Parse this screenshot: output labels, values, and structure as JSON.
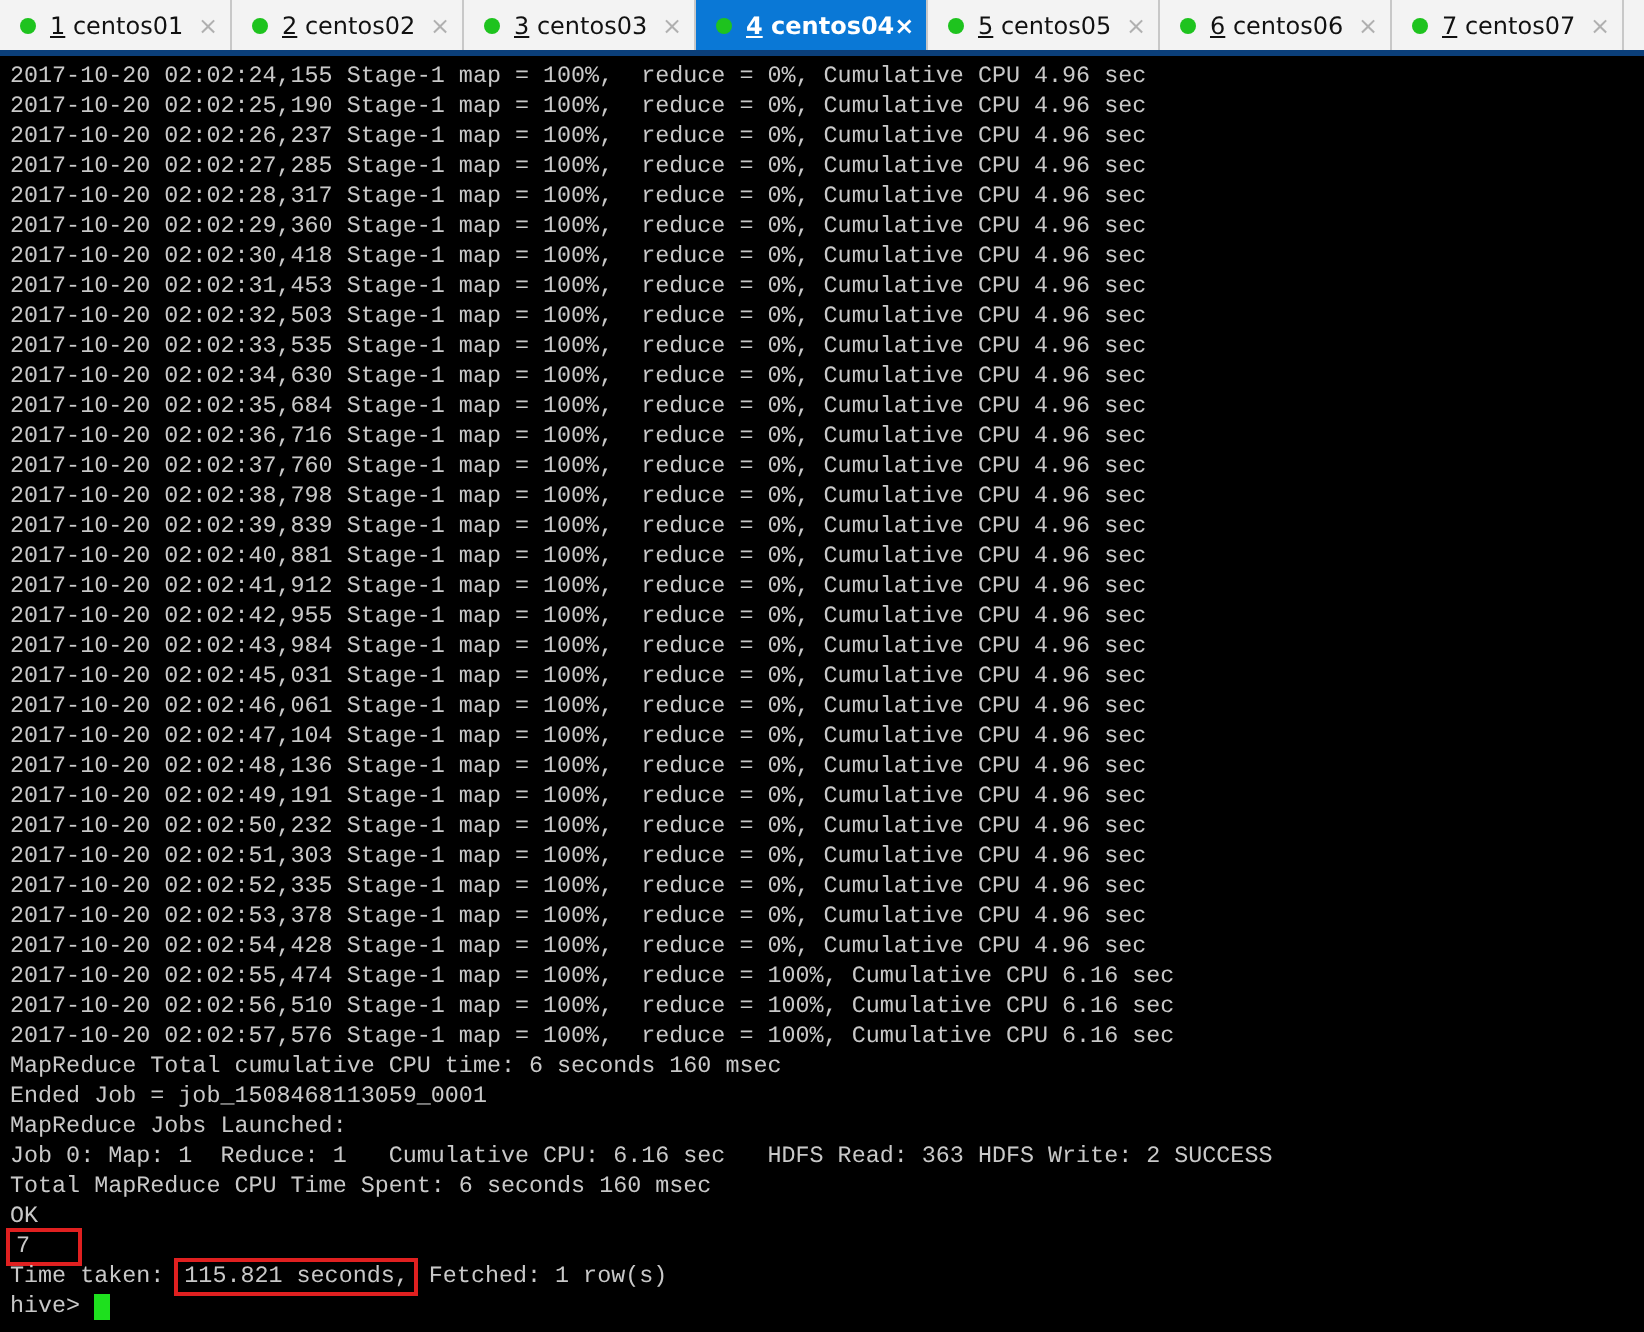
{
  "tabs": [
    {
      "number": "1",
      "label": "centos01",
      "selected": false,
      "color": "#1ec31e",
      "close": "×"
    },
    {
      "number": "2",
      "label": "centos02",
      "selected": false,
      "color": "#1ec31e",
      "close": "×"
    },
    {
      "number": "3",
      "label": "centos03",
      "selected": false,
      "color": "#1ec31e",
      "close": "×"
    },
    {
      "number": "4",
      "label": "centos04",
      "selected": true,
      "color": "#1ec31e",
      "close": "×"
    },
    {
      "number": "5",
      "label": "centos05",
      "selected": false,
      "color": "#1ec31e",
      "close": "×"
    },
    {
      "number": "6",
      "label": "centos06",
      "selected": false,
      "color": "#1ec31e",
      "close": "×"
    },
    {
      "number": "7",
      "label": "centos07",
      "selected": false,
      "color": "#1ec31e",
      "close": "×"
    }
  ],
  "terminal": {
    "lines": [
      {
        "kind": "plain",
        "text": "2017-10-20 02:02:24,155 Stage-1 map = 100%,  reduce = 0%, Cumulative CPU 4.96 sec"
      },
      {
        "kind": "plain",
        "text": "2017-10-20 02:02:25,190 Stage-1 map = 100%,  reduce = 0%, Cumulative CPU 4.96 sec"
      },
      {
        "kind": "plain",
        "text": "2017-10-20 02:02:26,237 Stage-1 map = 100%,  reduce = 0%, Cumulative CPU 4.96 sec"
      },
      {
        "kind": "plain",
        "text": "2017-10-20 02:02:27,285 Stage-1 map = 100%,  reduce = 0%, Cumulative CPU 4.96 sec"
      },
      {
        "kind": "plain",
        "text": "2017-10-20 02:02:28,317 Stage-1 map = 100%,  reduce = 0%, Cumulative CPU 4.96 sec"
      },
      {
        "kind": "plain",
        "text": "2017-10-20 02:02:29,360 Stage-1 map = 100%,  reduce = 0%, Cumulative CPU 4.96 sec"
      },
      {
        "kind": "plain",
        "text": "2017-10-20 02:02:30,418 Stage-1 map = 100%,  reduce = 0%, Cumulative CPU 4.96 sec"
      },
      {
        "kind": "plain",
        "text": "2017-10-20 02:02:31,453 Stage-1 map = 100%,  reduce = 0%, Cumulative CPU 4.96 sec"
      },
      {
        "kind": "plain",
        "text": "2017-10-20 02:02:32,503 Stage-1 map = 100%,  reduce = 0%, Cumulative CPU 4.96 sec"
      },
      {
        "kind": "plain",
        "text": "2017-10-20 02:02:33,535 Stage-1 map = 100%,  reduce = 0%, Cumulative CPU 4.96 sec"
      },
      {
        "kind": "plain",
        "text": "2017-10-20 02:02:34,630 Stage-1 map = 100%,  reduce = 0%, Cumulative CPU 4.96 sec"
      },
      {
        "kind": "plain",
        "text": "2017-10-20 02:02:35,684 Stage-1 map = 100%,  reduce = 0%, Cumulative CPU 4.96 sec"
      },
      {
        "kind": "plain",
        "text": "2017-10-20 02:02:36,716 Stage-1 map = 100%,  reduce = 0%, Cumulative CPU 4.96 sec"
      },
      {
        "kind": "plain",
        "text": "2017-10-20 02:02:37,760 Stage-1 map = 100%,  reduce = 0%, Cumulative CPU 4.96 sec"
      },
      {
        "kind": "plain",
        "text": "2017-10-20 02:02:38,798 Stage-1 map = 100%,  reduce = 0%, Cumulative CPU 4.96 sec"
      },
      {
        "kind": "plain",
        "text": "2017-10-20 02:02:39,839 Stage-1 map = 100%,  reduce = 0%, Cumulative CPU 4.96 sec"
      },
      {
        "kind": "plain",
        "text": "2017-10-20 02:02:40,881 Stage-1 map = 100%,  reduce = 0%, Cumulative CPU 4.96 sec"
      },
      {
        "kind": "plain",
        "text": "2017-10-20 02:02:41,912 Stage-1 map = 100%,  reduce = 0%, Cumulative CPU 4.96 sec"
      },
      {
        "kind": "plain",
        "text": "2017-10-20 02:02:42,955 Stage-1 map = 100%,  reduce = 0%, Cumulative CPU 4.96 sec"
      },
      {
        "kind": "plain",
        "text": "2017-10-20 02:02:43,984 Stage-1 map = 100%,  reduce = 0%, Cumulative CPU 4.96 sec"
      },
      {
        "kind": "plain",
        "text": "2017-10-20 02:02:45,031 Stage-1 map = 100%,  reduce = 0%, Cumulative CPU 4.96 sec"
      },
      {
        "kind": "plain",
        "text": "2017-10-20 02:02:46,061 Stage-1 map = 100%,  reduce = 0%, Cumulative CPU 4.96 sec"
      },
      {
        "kind": "plain",
        "text": "2017-10-20 02:02:47,104 Stage-1 map = 100%,  reduce = 0%, Cumulative CPU 4.96 sec"
      },
      {
        "kind": "plain",
        "text": "2017-10-20 02:02:48,136 Stage-1 map = 100%,  reduce = 0%, Cumulative CPU 4.96 sec"
      },
      {
        "kind": "plain",
        "text": "2017-10-20 02:02:49,191 Stage-1 map = 100%,  reduce = 0%, Cumulative CPU 4.96 sec"
      },
      {
        "kind": "plain",
        "text": "2017-10-20 02:02:50,232 Stage-1 map = 100%,  reduce = 0%, Cumulative CPU 4.96 sec"
      },
      {
        "kind": "plain",
        "text": "2017-10-20 02:02:51,303 Stage-1 map = 100%,  reduce = 0%, Cumulative CPU 4.96 sec"
      },
      {
        "kind": "plain",
        "text": "2017-10-20 02:02:52,335 Stage-1 map = 100%,  reduce = 0%, Cumulative CPU 4.96 sec"
      },
      {
        "kind": "plain",
        "text": "2017-10-20 02:02:53,378 Stage-1 map = 100%,  reduce = 0%, Cumulative CPU 4.96 sec"
      },
      {
        "kind": "plain",
        "text": "2017-10-20 02:02:54,428 Stage-1 map = 100%,  reduce = 0%, Cumulative CPU 4.96 sec"
      },
      {
        "kind": "plain",
        "text": "2017-10-20 02:02:55,474 Stage-1 map = 100%,  reduce = 100%, Cumulative CPU 6.16 sec"
      },
      {
        "kind": "plain",
        "text": "2017-10-20 02:02:56,510 Stage-1 map = 100%,  reduce = 100%, Cumulative CPU 6.16 sec"
      },
      {
        "kind": "plain",
        "text": "2017-10-20 02:02:57,576 Stage-1 map = 100%,  reduce = 100%, Cumulative CPU 6.16 sec"
      },
      {
        "kind": "plain",
        "text": "MapReduce Total cumulative CPU time: 6 seconds 160 msec"
      },
      {
        "kind": "plain",
        "text": "Ended Job = job_1508468113059_0001"
      },
      {
        "kind": "plain",
        "text": "MapReduce Jobs Launched:"
      },
      {
        "kind": "plain",
        "text": "Job 0: Map: 1  Reduce: 1   Cumulative CPU: 6.16 sec   HDFS Read: 363 HDFS Write: 2 SUCCESS"
      },
      {
        "kind": "plain",
        "text": "Total MapReduce CPU Time Spent: 6 seconds 160 msec"
      },
      {
        "kind": "plain",
        "text": "OK"
      },
      {
        "kind": "parts",
        "parts": [
          {
            "text": "7",
            "highlighted": true
          }
        ]
      },
      {
        "kind": "parts",
        "parts": [
          {
            "text": "Time taken: ",
            "highlighted": false
          },
          {
            "text": "115.821 seconds,",
            "highlighted": true
          },
          {
            "text": " Fetched: 1 row(s)",
            "highlighted": false
          }
        ]
      },
      {
        "kind": "prompt",
        "text": "hive>"
      }
    ]
  }
}
